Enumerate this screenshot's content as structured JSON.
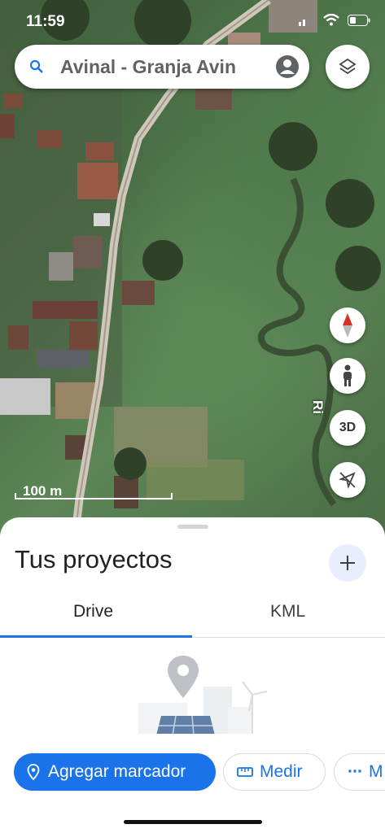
{
  "status_bar": {
    "time": "11:59"
  },
  "search": {
    "text": "Avinal - Granja Avin"
  },
  "map": {
    "scale_label": "100 m",
    "place_label": "Ri"
  },
  "controls": {
    "three_d_label": "3D"
  },
  "sheet": {
    "title": "Tus proyectos",
    "tabs": [
      "Drive",
      "KML"
    ],
    "active_tab": "Drive"
  },
  "actions": {
    "add_marker": "Agregar marcador",
    "measure": "Medir",
    "more": "M"
  },
  "colors": {
    "accent": "#1a73e8",
    "compass_red": "#d93025"
  },
  "icons": [
    "search-icon",
    "account-icon",
    "layers-icon",
    "compass-icon",
    "pegman-icon",
    "recenter-icon",
    "plus-icon",
    "pin-icon",
    "ruler-icon",
    "more-icon"
  ]
}
